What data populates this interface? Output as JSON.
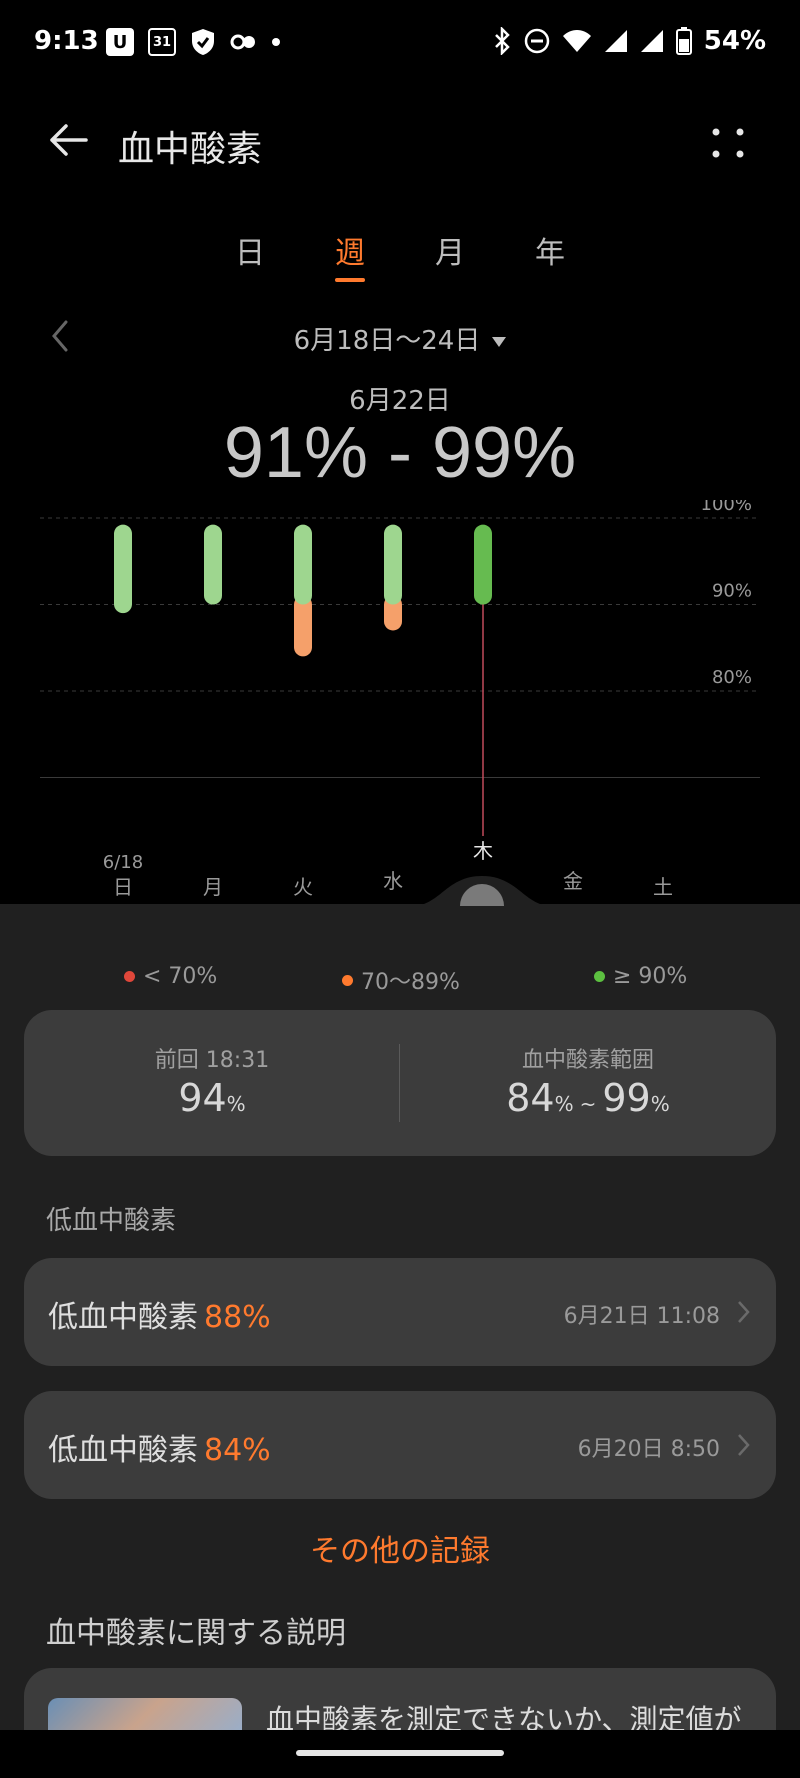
{
  "status_bar": {
    "time": "9:13",
    "left_icons": [
      "U",
      "31",
      "shield",
      "link",
      "dot"
    ],
    "right_icons": [
      "bluetooth-icon",
      "dnd-icon",
      "wifi-icon",
      "signal-icon",
      "signal-icon",
      "battery-icon"
    ],
    "battery": "54%"
  },
  "header": {
    "title": "血中酸素"
  },
  "tabs": [
    {
      "label": "日",
      "active": false
    },
    {
      "label": "週",
      "active": true
    },
    {
      "label": "月",
      "active": false
    },
    {
      "label": "年",
      "active": false
    }
  ],
  "range": {
    "label": "6月18日〜24日"
  },
  "selection": {
    "date": "6月22日",
    "value": "91% - 99%"
  },
  "chart_data": {
    "type": "bar",
    "subtype": "floating-range",
    "categories": [
      "日",
      "月",
      "火",
      "水",
      "木",
      "金",
      "土"
    ],
    "date_label": "6/18",
    "series": [
      {
        "name": "≥ 90%",
        "low": [
          89,
          90,
          90,
          90,
          90,
          null,
          null
        ],
        "high": [
          99,
          99,
          99,
          99,
          99,
          null,
          null
        ]
      },
      {
        "name": "70〜89%",
        "low": [
          null,
          null,
          84,
          87,
          null,
          null,
          null
        ],
        "high": [
          null,
          null,
          90,
          90,
          null,
          null,
          null
        ]
      }
    ],
    "selected_index": 4,
    "ytick_labels": [
      "100%",
      "90%",
      "80%"
    ],
    "yticks": [
      100,
      90,
      80,
      70
    ],
    "ylim": [
      70,
      100
    ],
    "colors": {
      "green": "#9ed68f",
      "green_selected": "#66bb50",
      "orange": "#f5a06a",
      "cursor": "#c04a5a",
      "grid": "#3a3a3a"
    }
  },
  "legend": [
    {
      "label": "< 70%",
      "color": "#e0473a"
    },
    {
      "label": "70〜89%",
      "color": "#ff7a2e"
    },
    {
      "label": "≥ 90%",
      "color": "#5cc040"
    }
  ],
  "summary": {
    "last_label": "前回 18:31",
    "last_value": "94",
    "range_label": "血中酸素範囲",
    "range_low": "84",
    "range_sep": "~",
    "range_high": "99",
    "unit": "%"
  },
  "low_section": {
    "title": "低血中酸素",
    "records": [
      {
        "label": "低血中酸素",
        "pct": "88%",
        "time": "6月21日 11:08"
      },
      {
        "label": "低血中酸素",
        "pct": "84%",
        "time": "6月20日 8:50"
      }
    ]
  },
  "more_records": "その他の記録",
  "info": {
    "title": "血中酸素に関する説明",
    "card_text": "血中酸素を測定できないか、測定値が"
  }
}
